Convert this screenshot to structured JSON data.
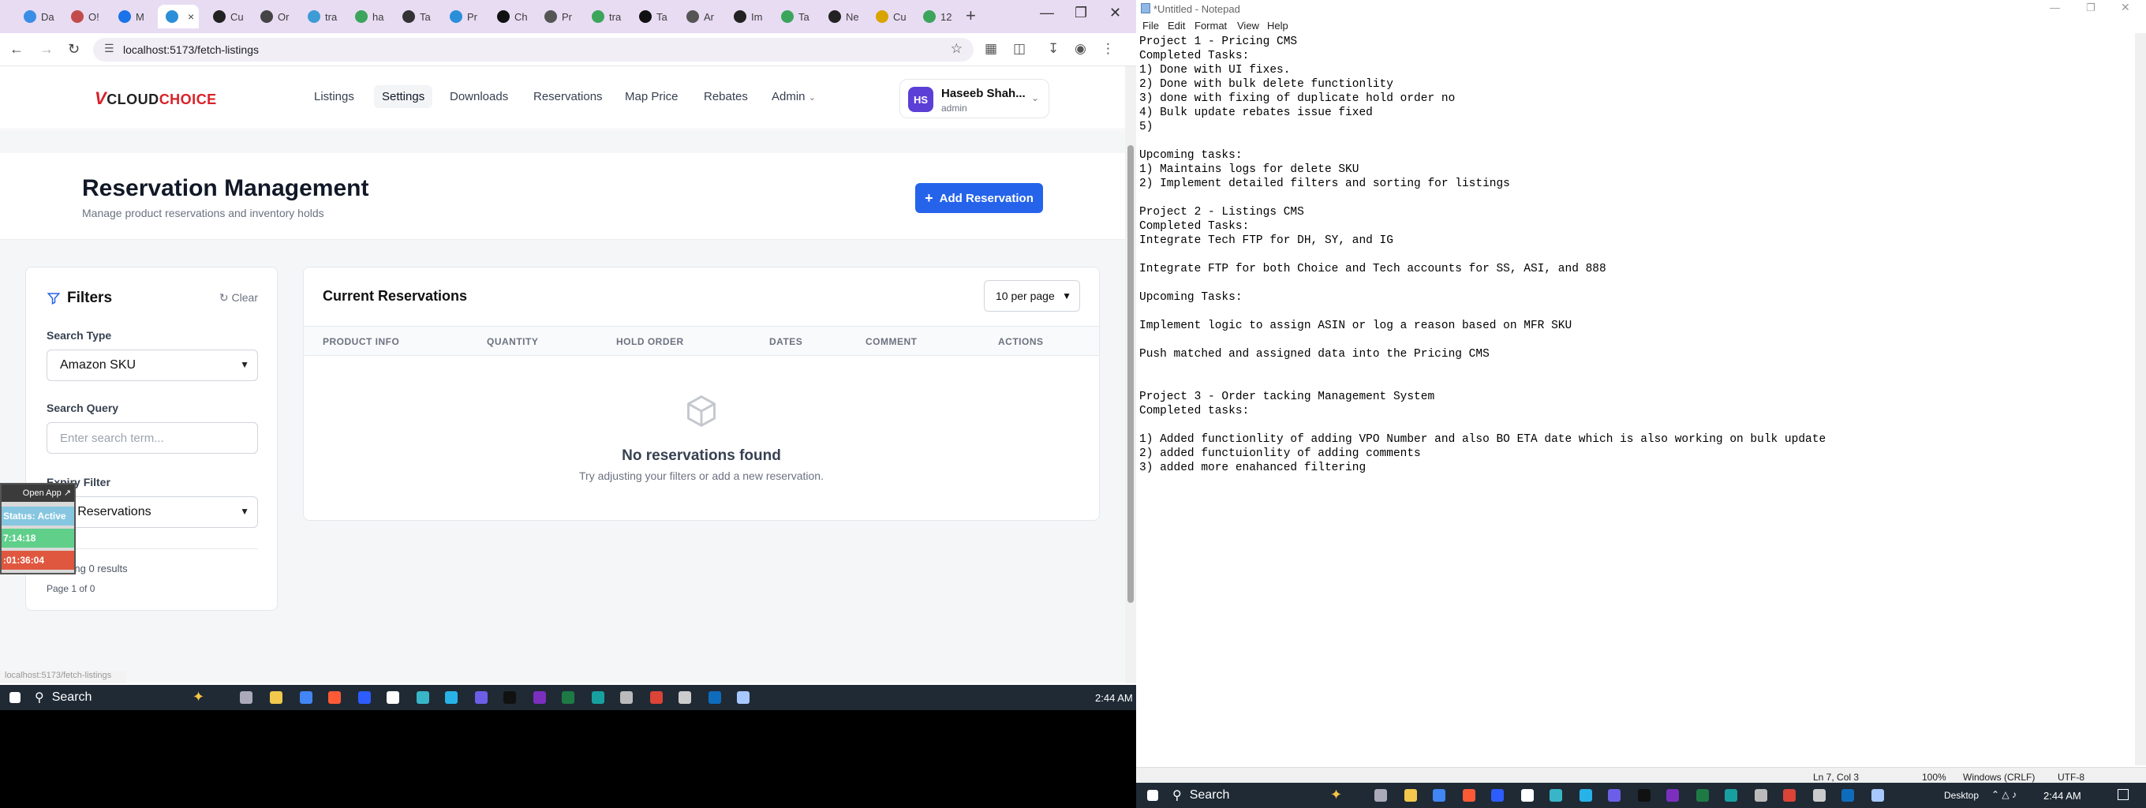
{
  "browser": {
    "tabs": [
      {
        "label": "Da",
        "color": "#3a8ee6"
      },
      {
        "label": "O!",
        "color": "#c24c4c"
      },
      {
        "label": "M",
        "color": "#1a73e8"
      },
      {
        "label": "",
        "color": "#2a8fd8",
        "active": true
      },
      {
        "label": "Cu",
        "color": "#222222"
      },
      {
        "label": "Or",
        "color": "#444444"
      },
      {
        "label": "tra",
        "color": "#3d9bd6"
      },
      {
        "label": "ha",
        "color": "#3ba55c"
      },
      {
        "label": "Ta",
        "color": "#333333"
      },
      {
        "label": "Pr",
        "color": "#2a8fd8"
      },
      {
        "label": "Ch",
        "color": "#111111"
      },
      {
        "label": "Pr",
        "color": "#555555"
      },
      {
        "label": "tra",
        "color": "#3ba55c"
      },
      {
        "label": "Ta",
        "color": "#111111"
      },
      {
        "label": "Ar",
        "color": "#555555"
      },
      {
        "label": "Im",
        "color": "#222222"
      },
      {
        "label": "Ta",
        "color": "#3ba55c"
      },
      {
        "label": "Ne",
        "color": "#222222"
      },
      {
        "label": "Cu",
        "color": "#d9a400"
      },
      {
        "label": "12",
        "color": "#3ba55c"
      }
    ],
    "url": "localhost:5173/fetch-listings",
    "status_url": "localhost:5173/fetch-listings"
  },
  "app": {
    "logo_v": "V",
    "logo_text": "CLOUD",
    "logo_accent": "CHOICE",
    "nav": [
      "Listings",
      "Settings",
      "Downloads",
      "Reservations",
      "Map Price",
      "Rebates",
      "Admin"
    ],
    "user": {
      "initials": "HS",
      "name": "Haseeb Shah...",
      "role": "admin"
    },
    "page_title": "Reservation Management",
    "page_subtitle": "Manage product reservations and inventory holds",
    "add_button": "Add Reservation",
    "filters": {
      "title": "Filters",
      "clear": "Clear",
      "search_type_label": "Search Type",
      "search_type_value": "Amazon SKU",
      "search_query_label": "Search Query",
      "search_query_placeholder": "Enter search term...",
      "expiry_label": "Expiry Filter",
      "expiry_value": "All Reservations",
      "showing": "Showing 0 results",
      "page": "Page 1 of 0"
    },
    "reservations": {
      "title": "Current Reservations",
      "per_page": "10 per page",
      "columns": [
        "PRODUCT INFO",
        "QUANTITY",
        "HOLD ORDER",
        "DATES",
        "COMMENT",
        "ACTIONS"
      ],
      "empty_title": "No reservations found",
      "empty_sub": "Try adjusting your filters or add a new reservation."
    },
    "overlay": {
      "open_app": "Open App",
      "status": "Status: Active",
      "timer1": "7:14:18",
      "timer2": ":01:36:04"
    }
  },
  "taskbar": {
    "search": "Search",
    "time": "2:44 AM",
    "desktop": "Desktop"
  },
  "notepad": {
    "title": "*Untitled - Notepad",
    "menu": [
      "File",
      "Edit",
      "Format",
      "View",
      "Help"
    ],
    "lines": [
      "Project 1 - Pricing CMS",
      "Completed Tasks:",
      "1) Done with UI fixes.",
      "2) Done with bulk delete functionlity",
      "3) done with fixing of duplicate hold order no",
      "4) Bulk update rebates issue fixed",
      "5)",
      "",
      "Upcoming tasks:",
      "1) Maintains logs for delete SKU",
      "2) Implement detailed filters and sorting for listings",
      "",
      "Project 2 - Listings CMS",
      "Completed Tasks:",
      "Integrate Tech FTP for DH, SY, and IG",
      "",
      "Integrate FTP for both Choice and Tech accounts for SS, ASI, and 888",
      "",
      "Upcoming Tasks:",
      "",
      "Implement logic to assign ASIN or log a reason based on MFR SKU",
      "",
      "Push matched and assigned data into the Pricing CMS",
      "",
      "",
      "Project 3 - Order tacking Management System",
      "Completed tasks:",
      "",
      "1) Added functionlity of adding VPO Number and also BO ETA date which is also working on bulk update",
      "2) added functuionlity of adding comments",
      "3) added more enahanced filtering"
    ],
    "status": {
      "position": "Ln 7, Col 3",
      "zoom": "100%",
      "eol": "Windows (CRLF)",
      "encoding": "UTF-8"
    }
  }
}
